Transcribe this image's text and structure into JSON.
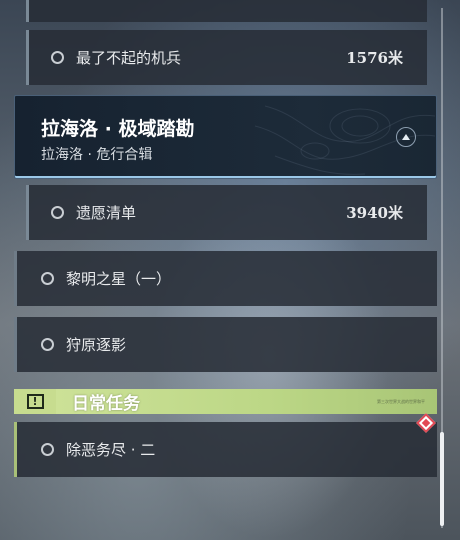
{
  "quest_list": {
    "top_sub_item": {
      "label": "最了不起的机兵",
      "distance": "1576米"
    },
    "region_header": {
      "title": "拉海洛 · 极域踏勘",
      "subtitle": "拉海洛 · 危行合辑"
    },
    "header_sub_item": {
      "label": "遗愿清单",
      "distance": "3940米"
    },
    "items": [
      {
        "label": "黎明之星（一）"
      },
      {
        "label": "狩原逐影"
      }
    ],
    "daily_section": {
      "title": "日常任务",
      "tiny_text": "第三次世界大战的世界和平"
    },
    "daily_items": [
      {
        "label": "除恶务尽 · 二"
      }
    ]
  }
}
